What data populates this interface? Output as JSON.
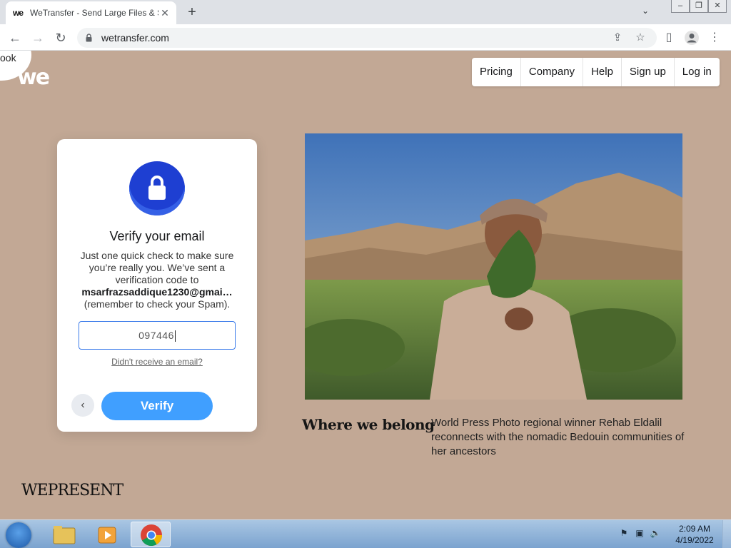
{
  "browser": {
    "tab_title": "WeTransfer - Send Large Files & Share Photos Online",
    "tab_favicon": "we",
    "url": "wetransfer.com"
  },
  "page": {
    "corner_text": "ook",
    "logo": "we",
    "nav": [
      "Pricing",
      "Company",
      "Help",
      "Sign up",
      "Log in"
    ],
    "verify_card": {
      "title": "Verify your email",
      "body_line1": "Just one quick check to make sure you’re really you. We’ve sent a verification code to",
      "email": "msarfrazsaddique1230@gmai…",
      "body_line2": "(remember to check your Spam).",
      "code_value": "097446",
      "resend_link": "Didn't receive an email?",
      "verify_label": "Verify"
    },
    "feature": {
      "title": "Where we belong",
      "description": "World Press Photo regional winner Rehab Eldalil reconnects with the nomadic Bedouin communities of her ancestors"
    },
    "brand_footer": "WEPRESENT",
    "colors": {
      "background": "#c2a895",
      "accent_blue": "#409fff",
      "lock_blue": "#1e3fd2"
    }
  },
  "taskbar": {
    "time": "2:09 AM",
    "date": "4/19/2022"
  }
}
